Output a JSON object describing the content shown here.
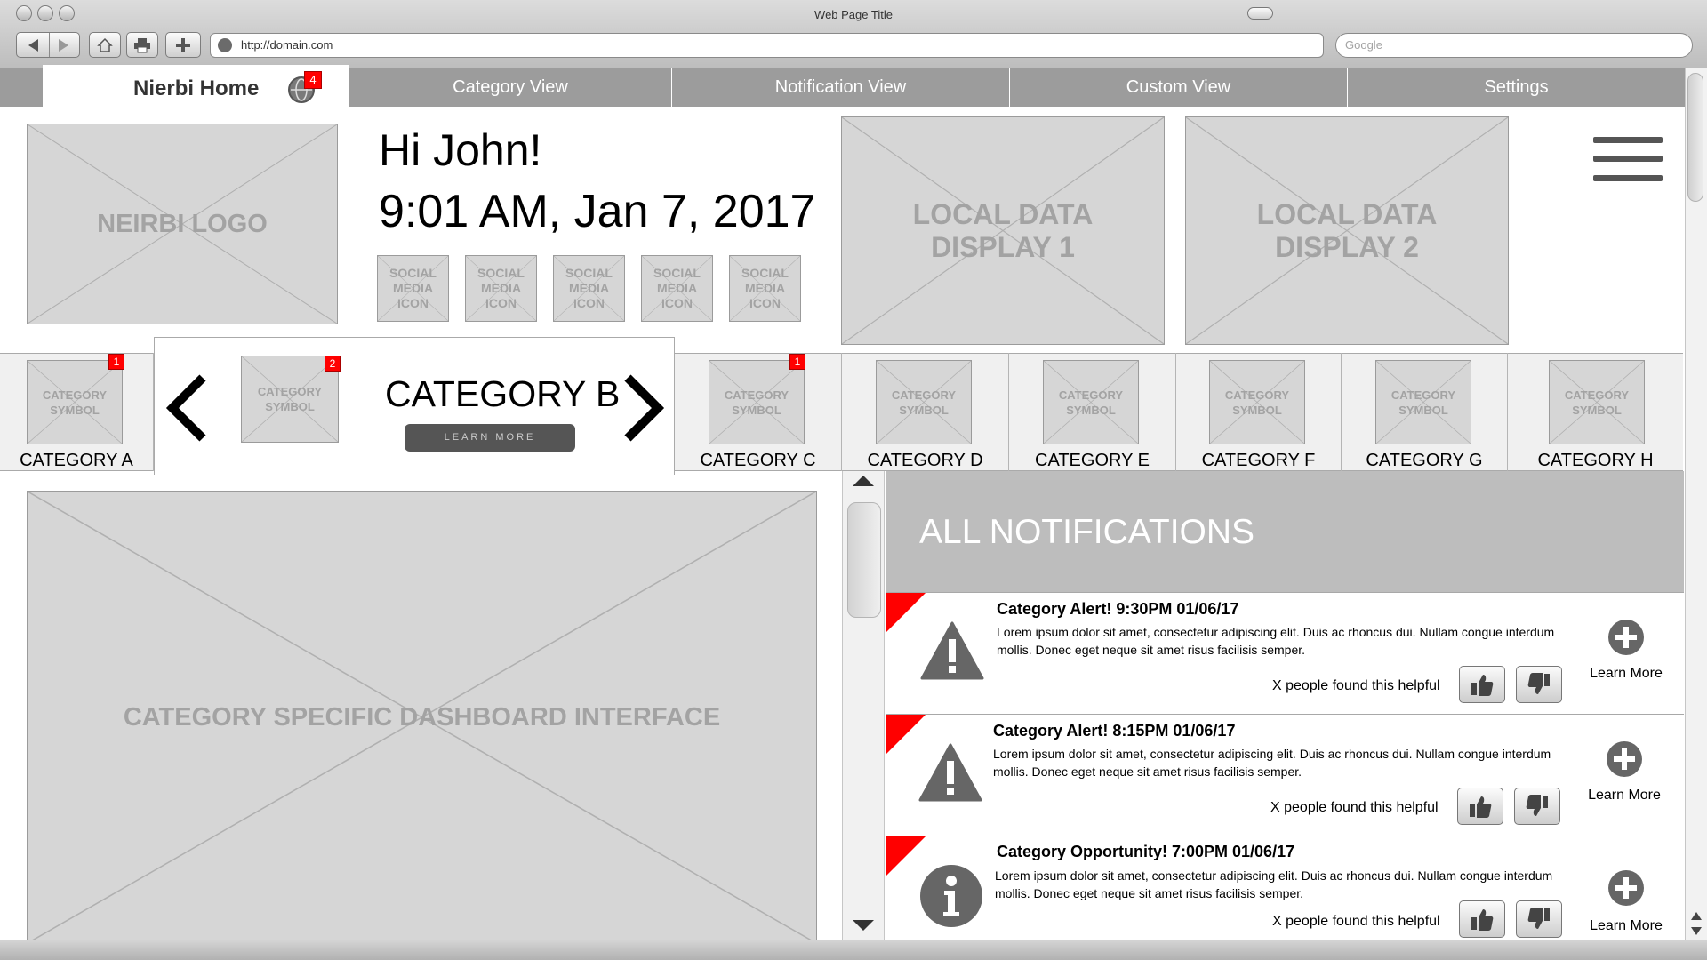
{
  "browser": {
    "window_title": "Web Page Title",
    "url": "http://domain.com",
    "search_placeholder": "Google"
  },
  "nav": {
    "home_label": "Nierbi Home",
    "home_badge": "4",
    "tabs": [
      "Category View",
      "Notification View",
      "Custom View",
      "Settings"
    ]
  },
  "header": {
    "logo": "NEIRBI LOGO",
    "greeting": "Hi John!",
    "datetime": "9:01 AM, Jan 7, 2017",
    "social_icons": [
      "SOCIAL MEDIA ICON",
      "SOCIAL MEDIA ICON",
      "SOCIAL MEDIA ICON",
      "SOCIAL MEDIA ICON",
      "SOCIAL MEDIA ICON"
    ],
    "local_data": [
      "LOCAL DATA DISPLAY 1",
      "LOCAL DATA DISPLAY 2"
    ]
  },
  "categories": {
    "symbol_text": "CATEGORY SYMBOL",
    "selected": {
      "title": "CATEGORY B",
      "badge": "2",
      "learn_more": "LEARN MORE"
    },
    "items": [
      {
        "label": "CATEGORY A",
        "badge": "1"
      },
      {
        "label": "CATEGORY C",
        "badge": "1"
      },
      {
        "label": "CATEGORY D",
        "badge": ""
      },
      {
        "label": "CATEGORY E",
        "badge": ""
      },
      {
        "label": "CATEGORY F",
        "badge": ""
      },
      {
        "label": "CATEGORY G",
        "badge": ""
      },
      {
        "label": "CATEGORY H",
        "badge": ""
      }
    ]
  },
  "dashboard": {
    "placeholder": "CATEGORY SPECIFIC DASHBOARD INTERFACE"
  },
  "notifications": {
    "header": "ALL NOTIFICATIONS",
    "items": [
      {
        "icon": "warning-icon",
        "title": "Category Alert!  9:30PM 01/06/17",
        "body": "Lorem ipsum dolor sit amet, consectetur adipiscing elit. Duis ac rhoncus dui. Nullam congue interdum mollis. Donec eget neque sit amet risus facilisis semper.",
        "helpful": "X people found this helpful",
        "learn_more": "Learn More"
      },
      {
        "icon": "warning-icon",
        "title": "Category Alert!  8:15PM 01/06/17",
        "body": "Lorem ipsum dolor sit amet, consectetur adipiscing elit. Duis ac rhoncus dui. Nullam congue interdum mollis. Donec eget neque sit amet risus facilisis semper.",
        "helpful": "X people found this helpful",
        "learn_more": "Learn More"
      },
      {
        "icon": "info-icon",
        "title": "Category Opportunity!  7:00PM 01/06/17",
        "body": "Lorem ipsum dolor sit amet, consectetur adipiscing elit. Duis ac rhoncus dui. Nullam congue interdum mollis. Donec eget neque sit amet risus facilisis semper.",
        "helpful": "X people found this helpful",
        "learn_more": "Learn More"
      }
    ]
  },
  "colors": {
    "accent": "#ff0000",
    "nav_bg": "#9c9c9c",
    "placeholder_bg": "#d6d6d6"
  }
}
